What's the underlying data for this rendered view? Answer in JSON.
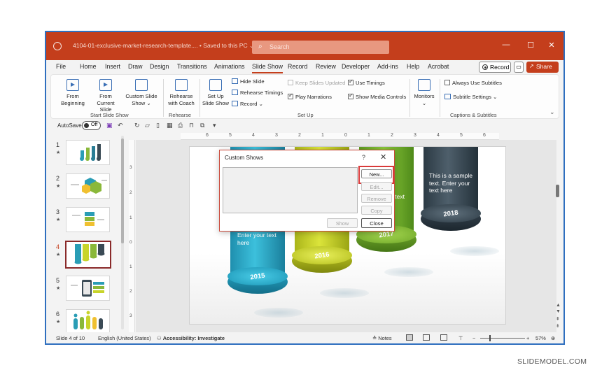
{
  "titlebar": {
    "file_title": "4104-01-exclusive-market-research-template.... • Saved to this PC ⌄",
    "search_placeholder": "Search",
    "minimize": "—",
    "maximize": "☐",
    "close": "✕"
  },
  "menu": {
    "tabs": [
      "File",
      "Home",
      "Insert",
      "Draw",
      "Design",
      "Transitions",
      "Animations",
      "Slide Show",
      "Record",
      "Review",
      "Developer",
      "Add-ins",
      "Help",
      "Acrobat"
    ],
    "active_tab": "Slide Show",
    "record_button": "Record",
    "share_button": "Share ⌄"
  },
  "ribbon": {
    "start_group": {
      "label": "Start Slide Show",
      "from_beginning": "From Beginning",
      "from_current": "From Current Slide",
      "custom_show": "Custom Slide Show ⌄"
    },
    "rehearse_group": {
      "label": "Rehearse",
      "rehearse_coach": "Rehearse with Coach"
    },
    "setup_group": {
      "label": "Set Up",
      "setup_show": "Set Up Slide Show",
      "hide_slide": "Hide Slide",
      "rehearse_timings": "Rehearse Timings",
      "record": "Record ⌄",
      "keep_updated": "Keep Slides Updated",
      "play_narrations": "Play Narrations",
      "use_timings": "Use Timings",
      "show_media": "Show Media Controls"
    },
    "monitors_group": {
      "monitors": "Monitors ⌄"
    },
    "captions_group": {
      "label": "Captions & Subtitles",
      "always_subtitles": "Always Use Subtitles",
      "subtitle_settings": "Subtitle Settings ⌄"
    }
  },
  "qat": {
    "autosave_label": "AutoSave",
    "toggle_state": "Off"
  },
  "ruler": {
    "h_numbers": [
      "6",
      "5",
      "4",
      "3",
      "2",
      "1",
      "0",
      "1",
      "2",
      "3",
      "4",
      "5",
      "6"
    ],
    "v_numbers": [
      "3",
      "2",
      "1",
      "0",
      "1",
      "2",
      "3"
    ]
  },
  "thumbnails": [
    {
      "num": "1",
      "star": "★"
    },
    {
      "num": "2",
      "star": "★"
    },
    {
      "num": "3",
      "star": "★"
    },
    {
      "num": "4",
      "star": "★"
    },
    {
      "num": "5",
      "star": "★"
    },
    {
      "num": "6",
      "star": "★"
    }
  ],
  "active_slide": 4,
  "slide": {
    "years": [
      "2015",
      "2016",
      "2017",
      "2018"
    ],
    "text_left": "Enter your text here",
    "text_mid": "t. text",
    "text_right": "This is a sample text. Enter your text here"
  },
  "dialog": {
    "title": "Custom Shows",
    "help": "?",
    "close": "✕",
    "buttons": [
      "New...",
      "Edit...",
      "Remove",
      "Copy"
    ],
    "show_button": "Show",
    "close_button": "Close"
  },
  "status": {
    "slide_count": "Slide 4 of 10",
    "language": "English (United States)",
    "accessibility": "Accessibility: Investigate",
    "notes": "Notes",
    "zoom": "57%"
  },
  "watermark": "SLIDEMODEL.COM",
  "colors": {
    "accent": "#c43e1c",
    "highlight": "#d93a3a"
  }
}
